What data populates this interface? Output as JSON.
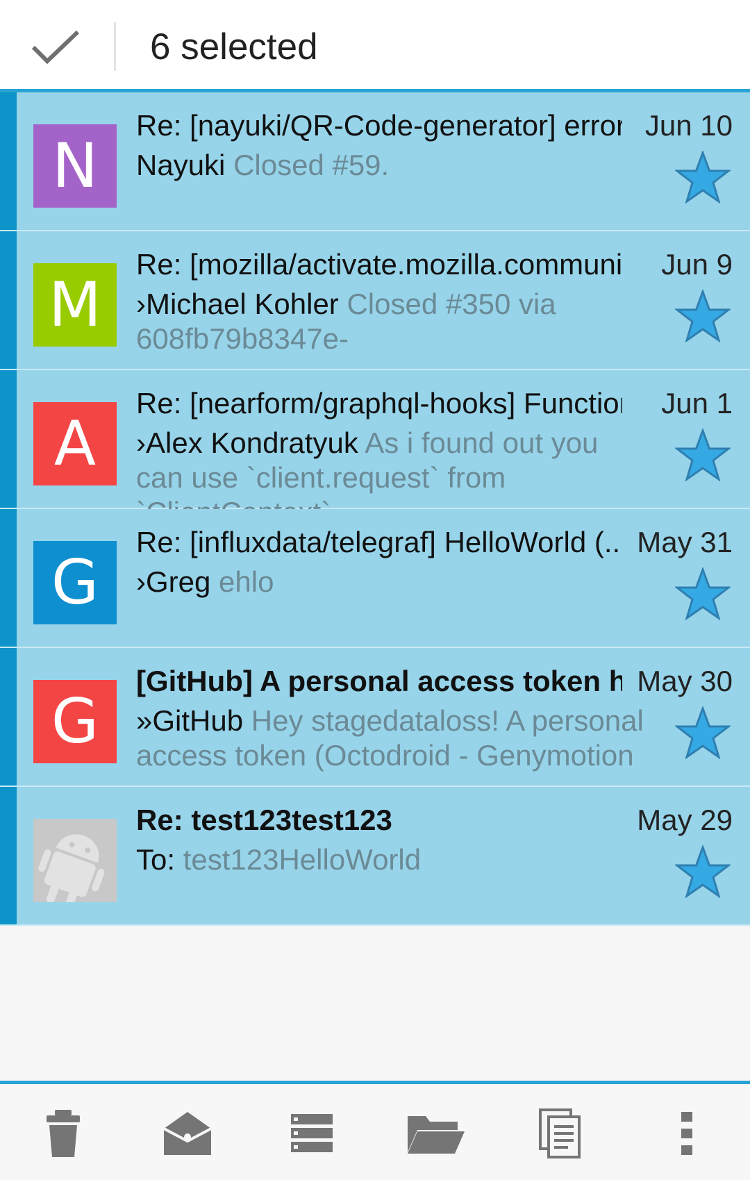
{
  "toolbar": {
    "title": "6 selected",
    "done_icon": "check-icon"
  },
  "colors": {
    "selected_row": "#97d4ea",
    "selection_bar": "#0e94c8",
    "accent": "#2aa3d5",
    "star": "#35a9e3"
  },
  "messages": [
    {
      "avatar_letter": "N",
      "avatar_color": "#a463c8",
      "subject": "Re: [nayuki/QR-Code-generator] error:..",
      "date": "Jun 10",
      "sender": "Nayuki",
      "snippet": "Closed #59.",
      "bold": false
    },
    {
      "avatar_letter": "M",
      "avatar_color": "#99cc00",
      "subject": "Re: [mozilla/activate.mozilla.communit..",
      "date": "Jun 9",
      "sender": "›Michael Kohler",
      "snippet": "Closed #350 via 608fb79b8347e-",
      "bold": false
    },
    {
      "avatar_letter": "A",
      "avatar_color": "#f44545",
      "subject": "Re: [nearform/graphql-hooks] Function..",
      "date": "Jun 1",
      "sender": "›Alex Kondratyuk",
      "snippet": "As i found out you can use `client.request` from `ClientContext`",
      "bold": false
    },
    {
      "avatar_letter": "G",
      "avatar_color": "#0e8fcf",
      "subject": "Re: [influxdata/telegraf] HelloWorld (..",
      "date": "May 31",
      "sender": "›Greg",
      "snippet": "ehlo",
      "bold": false
    },
    {
      "avatar_letter": "G",
      "avatar_color": "#f44545",
      "subject": "[GitHub] A personal access token ha..",
      "date": "May 30",
      "sender": "»GitHub",
      "snippet": "Hey stagedataloss! A personal access token (Octodroid - Genymotion",
      "bold": true
    },
    {
      "avatar_letter": "",
      "avatar_color": "#c8c8c8",
      "avatar_icon": "android-icon",
      "subject": "Re: test123test123",
      "date": "May 29",
      "sender": "To:",
      "snippet": "test123HelloWorld",
      "bold": true
    }
  ],
  "bottom_actions": [
    {
      "icon": "trash-icon"
    },
    {
      "icon": "mark-read-icon"
    },
    {
      "icon": "storage-icon"
    },
    {
      "icon": "folder-icon"
    },
    {
      "icon": "copy-icon"
    },
    {
      "icon": "overflow-menu-icon"
    }
  ]
}
